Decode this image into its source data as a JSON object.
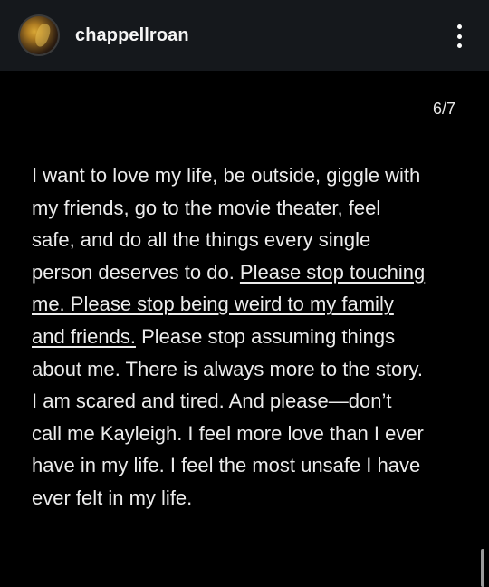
{
  "header": {
    "username": "chappellroan",
    "avatar_icon": "profile-photo-avatar",
    "menu_icon": "vertical-ellipsis-icon"
  },
  "slide": {
    "counter": "6/7",
    "text_before": " I want to love my life, be outside, giggle with\nmy friends, go to the movie theater, feel\nsafe, and do all the things every single\nperson deserves to do. ",
    "text_underlined": "Please stop touching\nme. Please stop being weird to my family\nand friends.",
    "text_after": " Please stop assuming things\nabout me. There is always more to the story.\nI am scared and tired. And please—don’t\ncall me Kayleigh. I feel more love than I ever\nhave in my life. I feel the most unsafe I have\never felt in my life."
  },
  "colors": {
    "background": "#000000",
    "header_background": "#15181c",
    "text": "#ececec"
  }
}
